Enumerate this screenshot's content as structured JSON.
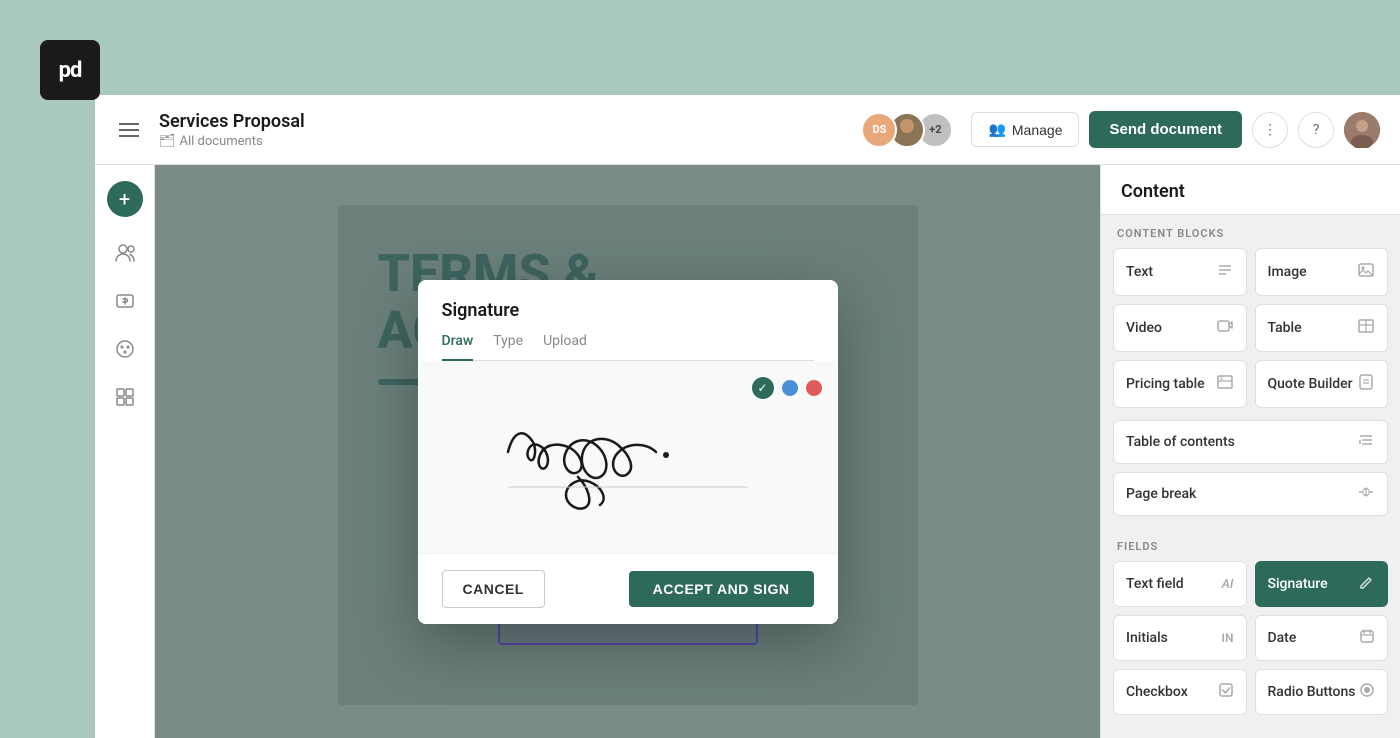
{
  "logo": {
    "text": "pd"
  },
  "header": {
    "menu_label": "menu",
    "title": "Services Proposal",
    "breadcrumb": "All documents",
    "avatars": [
      {
        "initials": "DS",
        "type": "initials"
      },
      {
        "type": "photo"
      },
      {
        "count": "+2",
        "type": "count"
      }
    ],
    "manage_label": "Manage",
    "send_label": "Send document",
    "more_icon": "⋮",
    "help_icon": "?",
    "user_avatar": "user"
  },
  "toolbar": {
    "add_icon": "+",
    "icons": [
      "people",
      "dollar",
      "grid",
      "palette"
    ]
  },
  "document": {
    "heading_line1": "TERMS &",
    "heading_line2": "AGREE"
  },
  "right_panel": {
    "title": "Content",
    "section_content_blocks": "CONTENT BLOCKS",
    "section_fields": "FIELDS",
    "blocks": [
      {
        "label": "Text",
        "icon": "≡"
      },
      {
        "label": "Image",
        "icon": "⊞"
      },
      {
        "label": "Video",
        "icon": "▶"
      },
      {
        "label": "Table",
        "icon": "⊟"
      },
      {
        "label": "Pricing table",
        "icon": "$≡"
      },
      {
        "label": "Quote Builder",
        "icon": "🏷"
      },
      {
        "label": "Table of contents",
        "icon": "≡"
      },
      {
        "label": "Page break",
        "icon": "✂"
      }
    ],
    "fields": [
      {
        "label": "Text field",
        "icon": "AI",
        "active": false
      },
      {
        "label": "Signature",
        "icon": "✏",
        "active": true
      },
      {
        "label": "Initials",
        "icon": "IN",
        "active": false
      },
      {
        "label": "Date",
        "icon": "📅",
        "active": false
      },
      {
        "label": "Checkbox",
        "icon": "☑",
        "active": false
      },
      {
        "label": "Radio Buttons",
        "icon": "⊙",
        "active": false
      }
    ]
  },
  "modal": {
    "title": "Signature",
    "tabs": [
      "Draw",
      "Type",
      "Upload"
    ],
    "active_tab": "Draw",
    "cancel_label": "CANCEL",
    "accept_label": "ACCEPT AND SIGN"
  }
}
